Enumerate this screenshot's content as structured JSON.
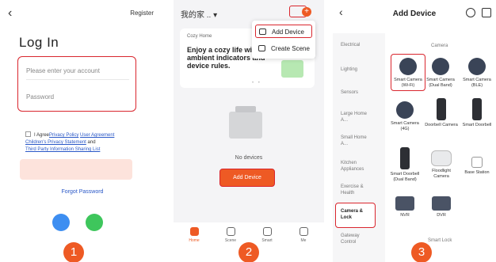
{
  "login": {
    "register": "Register",
    "title": "Log In",
    "account_placeholder": "Please enter your account",
    "password_placeholder": "Password",
    "agree_prefix": "I Agree",
    "privacy_policy": "Privacy Policy",
    "user_agreement": "User Agreement",
    "childrens_privacy": "Children's Privacy Statement",
    "and": "and",
    "third_party": "Third Party Information Sharing List",
    "forgot": "Forgot Password",
    "step": "1"
  },
  "home": {
    "title": "我的家 .. ▾",
    "plus": "+",
    "menu": {
      "add_device": "Add Device",
      "create_scene": "Create Scene"
    },
    "card": {
      "caption": "Cozy Home",
      "message": "Enjoy a cozy life with ambient indicators and device rules.",
      "dots": "• •"
    },
    "no_devices": "No devices",
    "add_button": "Add Device",
    "tabs": [
      {
        "label": "Home"
      },
      {
        "label": "Scene"
      },
      {
        "label": "Smart"
      },
      {
        "label": "Me"
      }
    ],
    "step": "2"
  },
  "add_device": {
    "title": "Add Device",
    "categories": [
      "Electrical",
      "Lighting",
      "Sensors",
      "Large Home A...",
      "Small Home A...",
      "Kitchen Appliances",
      "Exercise & Health",
      "Camera & Lock",
      "Gateway Control"
    ],
    "sections": {
      "camera": "Camera",
      "smart_lock": "Smart Lock"
    },
    "devices": [
      {
        "label": "Smart Camera (Wi-Fi)"
      },
      {
        "label": "Smart Camera (Dual Band)"
      },
      {
        "label": "Smart Camera (BLE)"
      },
      {
        "label": "Smart Camera (4G)"
      },
      {
        "label": "Doorbell Camera"
      },
      {
        "label": "Smart Doorbell"
      },
      {
        "label": "Smart Doorbell (Dual Band)"
      },
      {
        "label": "Floodlight Camera"
      },
      {
        "label": "Base Station"
      },
      {
        "label": "NVR"
      },
      {
        "label": "DVR"
      }
    ],
    "step": "3"
  },
  "colors": {
    "accent": "#ee5a24",
    "highlight": "#d9262e",
    "link": "#2a58c7"
  }
}
